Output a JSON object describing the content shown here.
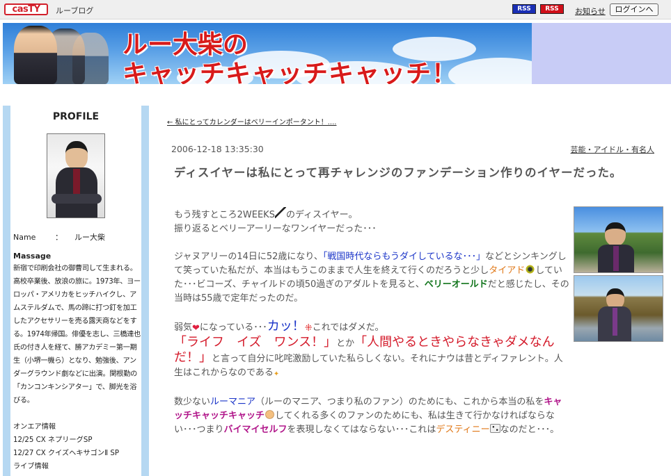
{
  "topbar": {
    "logo": "casTY",
    "blog_name": "ルーブログ",
    "rss1": "RSS",
    "rss2": "RSS",
    "notice": "お知らせ",
    "login": "ログインへ"
  },
  "banner": {
    "title_line1": "ルー大柴の",
    "title_line2": "キャッチキャッチキャッチ！"
  },
  "sidebar": {
    "heading": "PROFILE",
    "name_label": "Name",
    "name_sep": "：",
    "name_value": "ルー大柴",
    "massage_label": "Massage",
    "massage_text": "新宿で印刷会社の御曹司して生まれる。高校卒業後、放浪の旅に。1973年、ヨーロッパ・アメリカをヒッチハイクし、アムステルダムで、馬の蹄に打つ釘を加工したアクセサリーを売る露天商などをする。1974年帰国。俳優を志し、三橋達也氏の付き人を経て、勝アカデミー第一期生（小堺一機ら）となり、勉強後、アンダーグラウンド劇などに出演。関根勤の「カンコンキンシアター」で、脚光を浴びる。",
    "onair_head": "オンエア情報",
    "onair_1": "12/25 CX ネプリーグSP",
    "onair_2": "12/27 CX クイズヘキサゴンⅡ SP",
    "onair_3": "ライブ情報"
  },
  "post": {
    "back_link": "← 私にとってカレンダーはベリーインポータント！....",
    "date": "2006-12-18 13:35:30",
    "category": "芸能・アイドル・有名人",
    "title": "ディスイヤーは私にとって再チャレンジのファンデーション作りのイヤーだった。",
    "p1_a": "もう残すところ2WEEKS",
    "p1_b": "のディスイヤー。",
    "p1_c": "振り返るとベリーアーリーなワンイヤーだった･･･",
    "p2_a": "ジャヌアリーの14日に52歳になり、",
    "p2_b": "「戦国時代ならもうダイしているな･･･」",
    "p2_c": "などとシンキングして笑っていた私だが、本当はもうこのままで人生を終えて行くのだろうと少し",
    "p2_d": "タイアド",
    "p2_e": "していた･･･ビコーズ、チャイルドの頃50過ぎのアダルトを見ると、",
    "p2_f": "ベリーオールド",
    "p2_g": "だと感じたし、その当時は55歳で定年だったのだ。",
    "p3_a": "弱気",
    "p3_b": "になっている･･･",
    "p3_c": "カッ！",
    "p3_d": "これではダメだ。",
    "p3_e": "「ライフ　イズ　ワンス！」",
    "p3_f": "とか",
    "p3_g": "「人間やるときやらなきゃダメなんだ！」",
    "p3_h": "と言って自分に叱咤激励していた私らしくない。それにナウは昔とディファレント。人生はこれからなのである",
    "p4_a": "数少ない",
    "p4_b": "ルーマニア",
    "p4_c": "（ルーのマニア、つまり私のファン）のためにも、これから本当の私を",
    "p4_d": "キャッチキャッチキャッチ",
    "p4_e": "してくれる多くのファンのためにも、私は生きて行かなければならない･･･つまり",
    "p4_f": "バイマイセルフ",
    "p4_g": "を表現しなくてはならない･･･これは",
    "p4_h": "デスティニー",
    "p4_i": "なのだと･･･。"
  },
  "colors": {
    "accent_red": "#d41a2a",
    "link_blue": "#1a34c8",
    "sidebar_blue": "#b6d8f2",
    "banner_lavender": "#c8ccf6"
  }
}
